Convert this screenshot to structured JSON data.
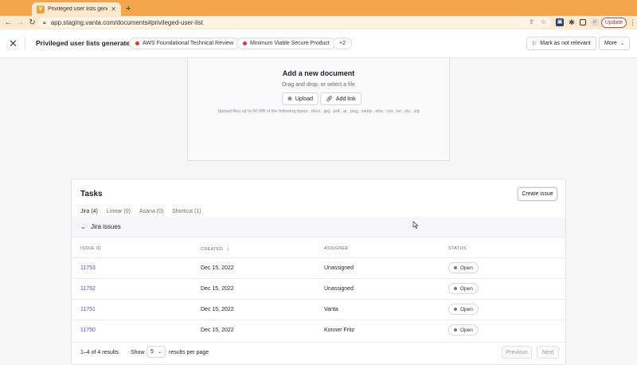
{
  "browser": {
    "tab_title": "Privileged user lists generated",
    "tab_favicon": "V",
    "url": "app.staging.vanta.com/documents#privileged-user-list",
    "update_label": "Update"
  },
  "header": {
    "title": "Privileged user lists generated",
    "pills": [
      "AWS Foundational Technical Review",
      "Minimum Viable Secure Product",
      "+2"
    ],
    "mark_label": "Mark as not relevant",
    "more_label": "More"
  },
  "upload": {
    "title": "Add a new document",
    "subtitle": "Drag and drop, or select a file",
    "upload_label": "Upload",
    "link_label": "Add link",
    "note": "Upload files up to 50 MB of the following types: .docx, .jpg, .pdf, .ai, .png, .webp, .xlsx, .csv, .txt, .xls, .zip"
  },
  "tasks": {
    "title": "Tasks",
    "create_label": "Create issue",
    "tabs": [
      "Jira (4)",
      "Linear (0)",
      "Asana (0)",
      "Shortcut (1)"
    ],
    "group_label": "Jira issues",
    "columns": [
      "ISSUE ID",
      "CREATED",
      "ASSIGNEE",
      "STATUS"
    ],
    "rows": [
      {
        "id": "11753",
        "created": "Dec 15, 2022",
        "assignee": "Unassigned",
        "status": "Open"
      },
      {
        "id": "11752",
        "created": "Dec 15, 2022",
        "assignee": "Unassigned",
        "status": "Open"
      },
      {
        "id": "11751",
        "created": "Dec 15, 2022",
        "assignee": "Vanta",
        "status": "Open"
      },
      {
        "id": "11750",
        "created": "Dec 15, 2022",
        "assignee": "Konner Fritz",
        "status": "Open"
      }
    ],
    "footer": {
      "count": "1–4 of 4 results",
      "show_label": "Show",
      "page_size": "5",
      "rpp_label": "results per page",
      "prev_label": "Previous",
      "next_label": "Next"
    }
  },
  "colors": {
    "accent": "#5a48d0",
    "chrome": "#f4a74a",
    "pill_dot": "#d43b3b"
  }
}
